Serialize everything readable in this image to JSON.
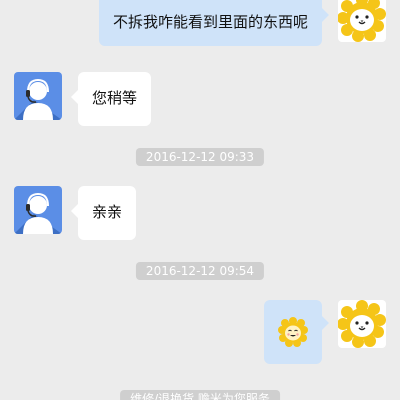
{
  "messages": [
    {
      "side": "out",
      "kind": "text",
      "text": "不拆我咋能看到里面的东西呢",
      "avatar_icon": "suning-lion-icon"
    },
    {
      "side": "in",
      "kind": "text",
      "text": "您稍等",
      "avatar_icon": "agent-avatar-icon"
    },
    {
      "kind": "timestamp",
      "text": "2016-12-12 09:33"
    },
    {
      "side": "in",
      "kind": "text",
      "text": "亲亲",
      "avatar_icon": "agent-avatar-icon"
    },
    {
      "kind": "timestamp",
      "text": "2016-12-12 09:54"
    },
    {
      "side": "out",
      "kind": "emoji",
      "emoji_icon": "smiling-lion-emoji-icon",
      "avatar_icon": "suning-lion-icon"
    },
    {
      "kind": "system",
      "text": "维修/退换货 赡米为您服务"
    }
  ],
  "colors": {
    "background": "#ececec",
    "outgoing_bubble": "#cfe3f9",
    "incoming_bubble": "#ffffff",
    "timestamp_pill": "#cfcfcf",
    "lion_yellow": "#f5c518",
    "agent_avatar_bg": "#5b8ee6"
  }
}
